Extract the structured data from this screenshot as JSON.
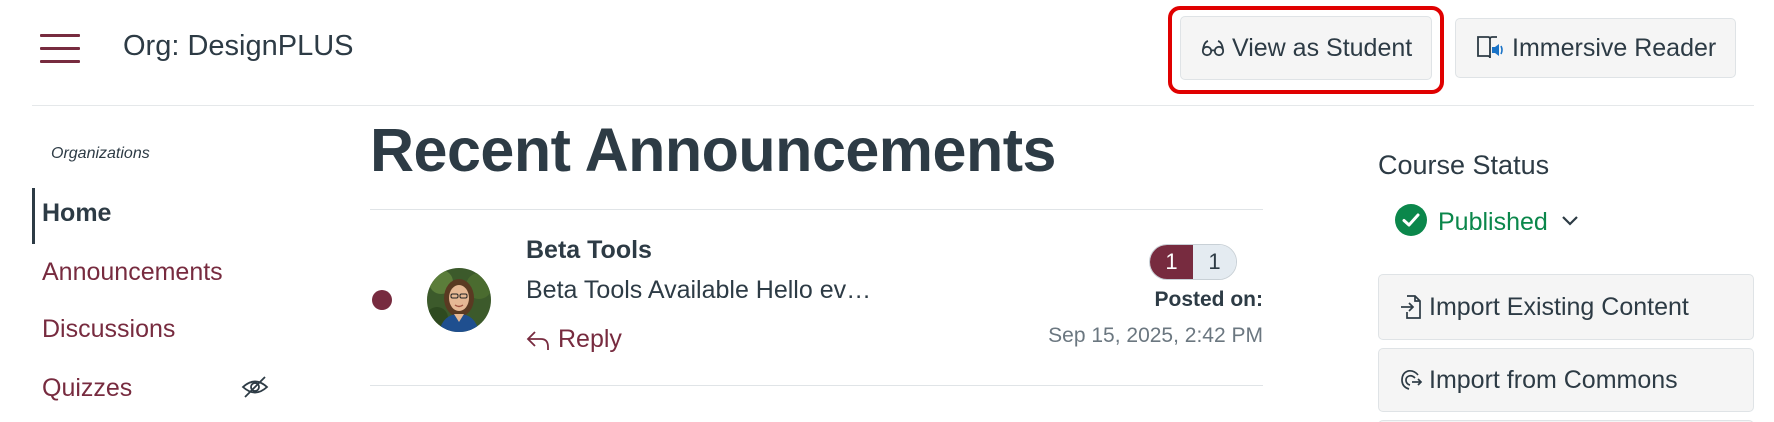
{
  "header": {
    "org_title": "Org: DesignPLUS",
    "view_as_student_label": "View as Student",
    "immersive_reader_label": "Immersive Reader"
  },
  "nav": {
    "section_label": "Organizations",
    "items": [
      {
        "label": "Home",
        "active": true
      },
      {
        "label": "Announcements",
        "active": false
      },
      {
        "label": "Discussions",
        "active": false
      },
      {
        "label": "Quizzes",
        "active": false,
        "hidden_icon": "eye-slash-icon"
      }
    ]
  },
  "main": {
    "title": "Recent Announcements",
    "announcement": {
      "title": "Beta Tools",
      "snippet": "Beta Tools Available Hello ev…",
      "reply_label": "Reply",
      "unread_count": "1",
      "total_count": "1",
      "posted_label": "Posted on:",
      "posted_date": "Sep 15, 2025, 2:42 PM"
    }
  },
  "sidebar": {
    "status_heading": "Course Status",
    "status_value": "Published",
    "buttons": [
      {
        "label": "Import Existing Content",
        "icon": "import-icon"
      },
      {
        "label": "Import from Commons",
        "icon": "commons-icon"
      }
    ]
  },
  "colors": {
    "brand": "#772b3f",
    "text": "#2d3b45",
    "success": "#0b874b",
    "highlight": "#e00000"
  }
}
